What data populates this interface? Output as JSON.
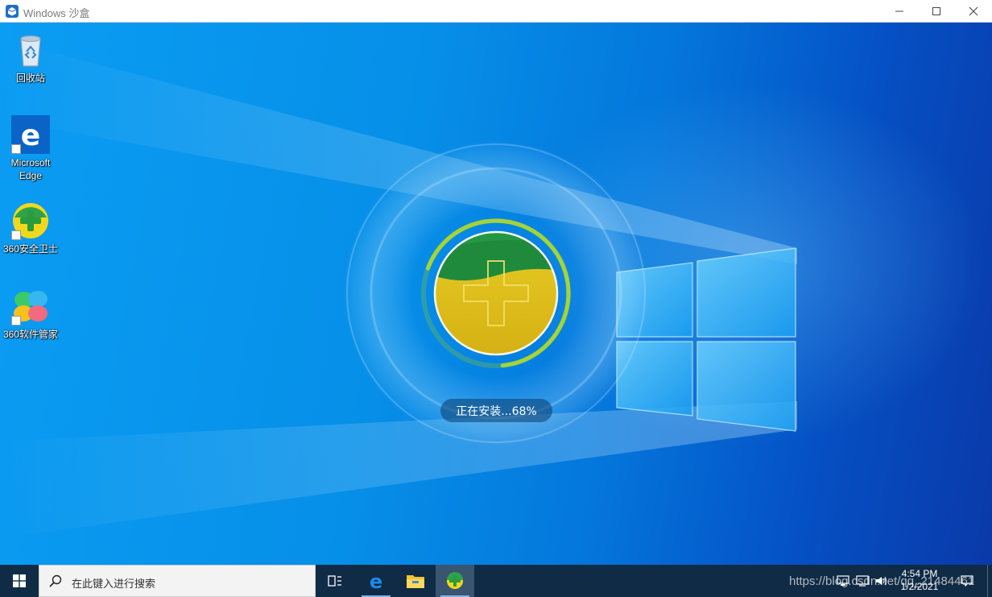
{
  "window": {
    "title": "Windows 沙盒"
  },
  "desktop": {
    "icons": [
      {
        "label": "回收站",
        "icon": "recycle-bin-icon"
      },
      {
        "label": "Microsoft Edge",
        "icon": "edge-icon",
        "shortcut": true
      },
      {
        "label": "360安全卫士",
        "icon": "360-safe-icon",
        "shortcut": true
      },
      {
        "label": "360软件管家",
        "icon": "360-software-manager-icon",
        "shortcut": true
      }
    ]
  },
  "installer": {
    "status_text": "正在安装...68%",
    "progress_percent": 68,
    "ring_color": "#a4d43a",
    "fill_color": "#e0c21a",
    "top_color": "#1f8a3c"
  },
  "taskbar": {
    "search_placeholder": "在此键入进行搜索",
    "items": [
      "task-view-icon",
      "edge-icon",
      "file-explorer-icon",
      "360-installer-icon"
    ],
    "clock_time": "4:54 PM",
    "clock_date": "1/2/2021",
    "watermark": "https://blog.csdn.net/qq_21484461"
  },
  "colors": {
    "taskbar_bg": "#102b46",
    "desktop_accent": "#068fe8"
  }
}
